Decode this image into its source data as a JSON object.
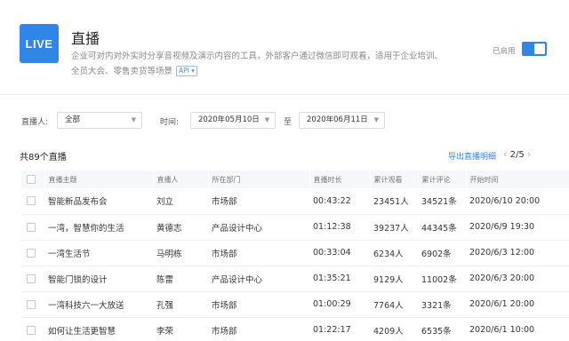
{
  "header": {
    "logo_text": "LIVE",
    "title": "直播",
    "desc_line1": "企业可对内对外实时分享音视频及演示内容的工具，外部客户通过微信即可观看，适用于企业培训、",
    "desc_line2": "全员大会、零售卖货等场景",
    "api_tag": "API ▾",
    "enabled_label": "已启用",
    "accent": "#2f86e6"
  },
  "filters": {
    "host_label": "直播人:",
    "host_value": "全部",
    "time_label": "时间:",
    "date_from": "2020年05月10日",
    "to_label": "至",
    "date_to": "2020年06月11日"
  },
  "list": {
    "count_label": "共89个直播",
    "export_label": "导出直播明细",
    "page": "2/5"
  },
  "table": {
    "columns": [
      "直播主题",
      "直播人",
      "所在部门",
      "直播时长",
      "累计观看",
      "累计评论",
      "开始时间"
    ],
    "rows": [
      [
        "智能新品发布会",
        "刘立",
        "市场部",
        "00:43:22",
        "23451人",
        "34521条",
        "2020/6/10 20:00"
      ],
      [
        "一湾，智慧你的生活",
        "黄德志",
        "产品设计中心",
        "01:12:38",
        "39237人",
        "44345条",
        "2020/6/9 19:30"
      ],
      [
        "一湾生活节",
        "马明栋",
        "市场部",
        "00:33:04",
        "6234人",
        "6902条",
        "2020/6/3 12:00"
      ],
      [
        "智能门锁的设计",
        "陈雷",
        "产品设计中心",
        "01:35:21",
        "9129人",
        "11002条",
        "2020/6/3 20:00"
      ],
      [
        "一湾科技六一大放送",
        "孔强",
        "市场部",
        "01:00:29",
        "7764人",
        "3321条",
        "2020/6/1 20:00"
      ],
      [
        "如何让生活更智慧",
        "李荣",
        "市场部",
        "01:22:17",
        "4209人",
        "6535条",
        "2020/6/1 10:00"
      ]
    ]
  }
}
